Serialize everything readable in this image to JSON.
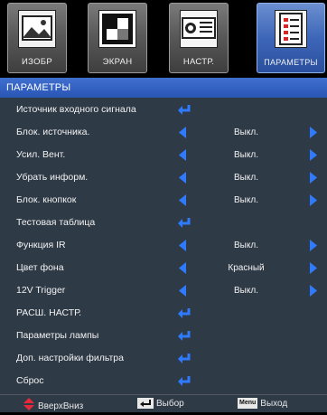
{
  "tabs": [
    {
      "label": "ИЗОБР",
      "icon": "picture-icon"
    },
    {
      "label": "ЭКРАН",
      "icon": "screen-icon"
    },
    {
      "label": "НАСТР.",
      "icon": "setup-icon"
    },
    {
      "label": "ПАРАМЕТРЫ",
      "icon": "options-icon",
      "active": true
    }
  ],
  "header": {
    "title": "ПАРАМЕТРЫ"
  },
  "menu": [
    {
      "label": "Источник входного сигнала",
      "type": "enter"
    },
    {
      "label": "Блок. источника.",
      "type": "select",
      "value": "Выкл."
    },
    {
      "label": "Усил. Вент.",
      "type": "select",
      "value": "Выкл."
    },
    {
      "label": "Убрать информ.",
      "type": "select",
      "value": "Выкл."
    },
    {
      "label": "Блок. кнопкок",
      "type": "select",
      "value": "Выкл."
    },
    {
      "label": "Тестовая таблица",
      "type": "enter"
    },
    {
      "label": "Функция IR",
      "type": "select",
      "value": "Выкл."
    },
    {
      "label": "Цвет фона",
      "type": "select",
      "value": "Красный"
    },
    {
      "label": "12V Trigger",
      "type": "select",
      "value": "Выкл."
    },
    {
      "label": "РАСШ. НАСТР.",
      "type": "enter"
    },
    {
      "label": "Параметры лампы",
      "type": "enter"
    },
    {
      "label": "Доп. настройки фильтра",
      "type": "enter"
    },
    {
      "label": "Сброс",
      "type": "enter"
    }
  ],
  "footer": {
    "nav_label": "ВверхВниз",
    "select_label": "Выбор",
    "menu_key": "Menu",
    "exit_label": "Выход"
  },
  "colors": {
    "accent": "#3f6fcf",
    "arrow": "#2f7bff",
    "panel": "#2f3a47",
    "footer_arrow": "#e5283a"
  }
}
